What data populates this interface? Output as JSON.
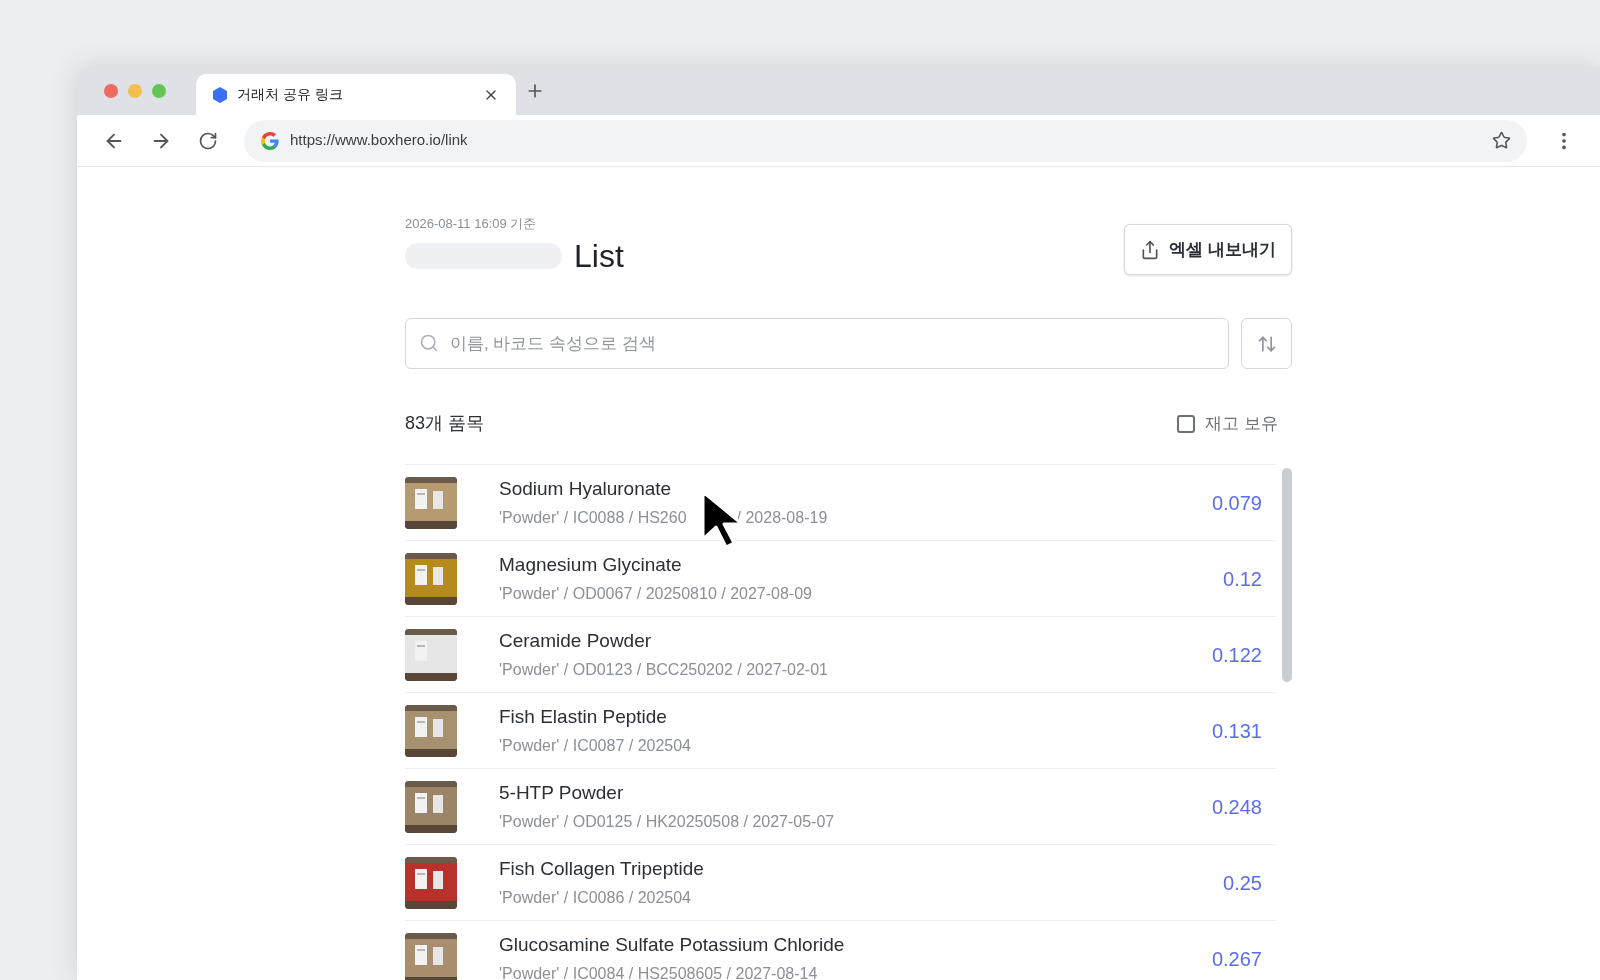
{
  "browser": {
    "tab": {
      "title": "거래처 공유 링크"
    },
    "url": "https://www.boxhero.io/link"
  },
  "header": {
    "timestamp": "2026-08-11 16:09 기준",
    "title": "List",
    "export_button": "엑셀 내보내기"
  },
  "search": {
    "placeholder": "이름, 바코드 속성으로 검색"
  },
  "summary": {
    "count": "83개 품목",
    "in_stock_filter": {
      "label": "재고 보유",
      "checked": false
    }
  },
  "items": [
    {
      "name": "Sodium Hyaluronate",
      "subtitle_parts": [
        "'Powder' / IC0088 / HS260",
        "/ 2028-08-19"
      ],
      "value": "0.079"
    },
    {
      "name": "Magnesium Glycinate",
      "subtitle_parts": [
        "'Powder' / OD0067 / 20250810 / 2027-08-09"
      ],
      "value": "0.12"
    },
    {
      "name": "Ceramide Powder",
      "subtitle_parts": [
        "'Powder' / OD0123 / BCC250202 / 2027-02-01"
      ],
      "value": "0.122"
    },
    {
      "name": "Fish Elastin Peptide",
      "subtitle_parts": [
        "'Powder' / IC0087 / 202504"
      ],
      "value": "0.131"
    },
    {
      "name": "5-HTP Powder",
      "subtitle_parts": [
        "'Powder' / OD0125 / HK20250508 / 2027-05-07"
      ],
      "value": "0.248"
    },
    {
      "name": "Fish Collagen Tripeptide",
      "subtitle_parts": [
        "'Powder' / IC0086 / 202504"
      ],
      "value": "0.25"
    },
    {
      "name": "Glucosamine Sulfate Potassium Chloride",
      "subtitle_parts": [
        "'Powder' / IC0084 / HS2508605 / 2027-08-14"
      ],
      "value": "0.267"
    }
  ]
}
